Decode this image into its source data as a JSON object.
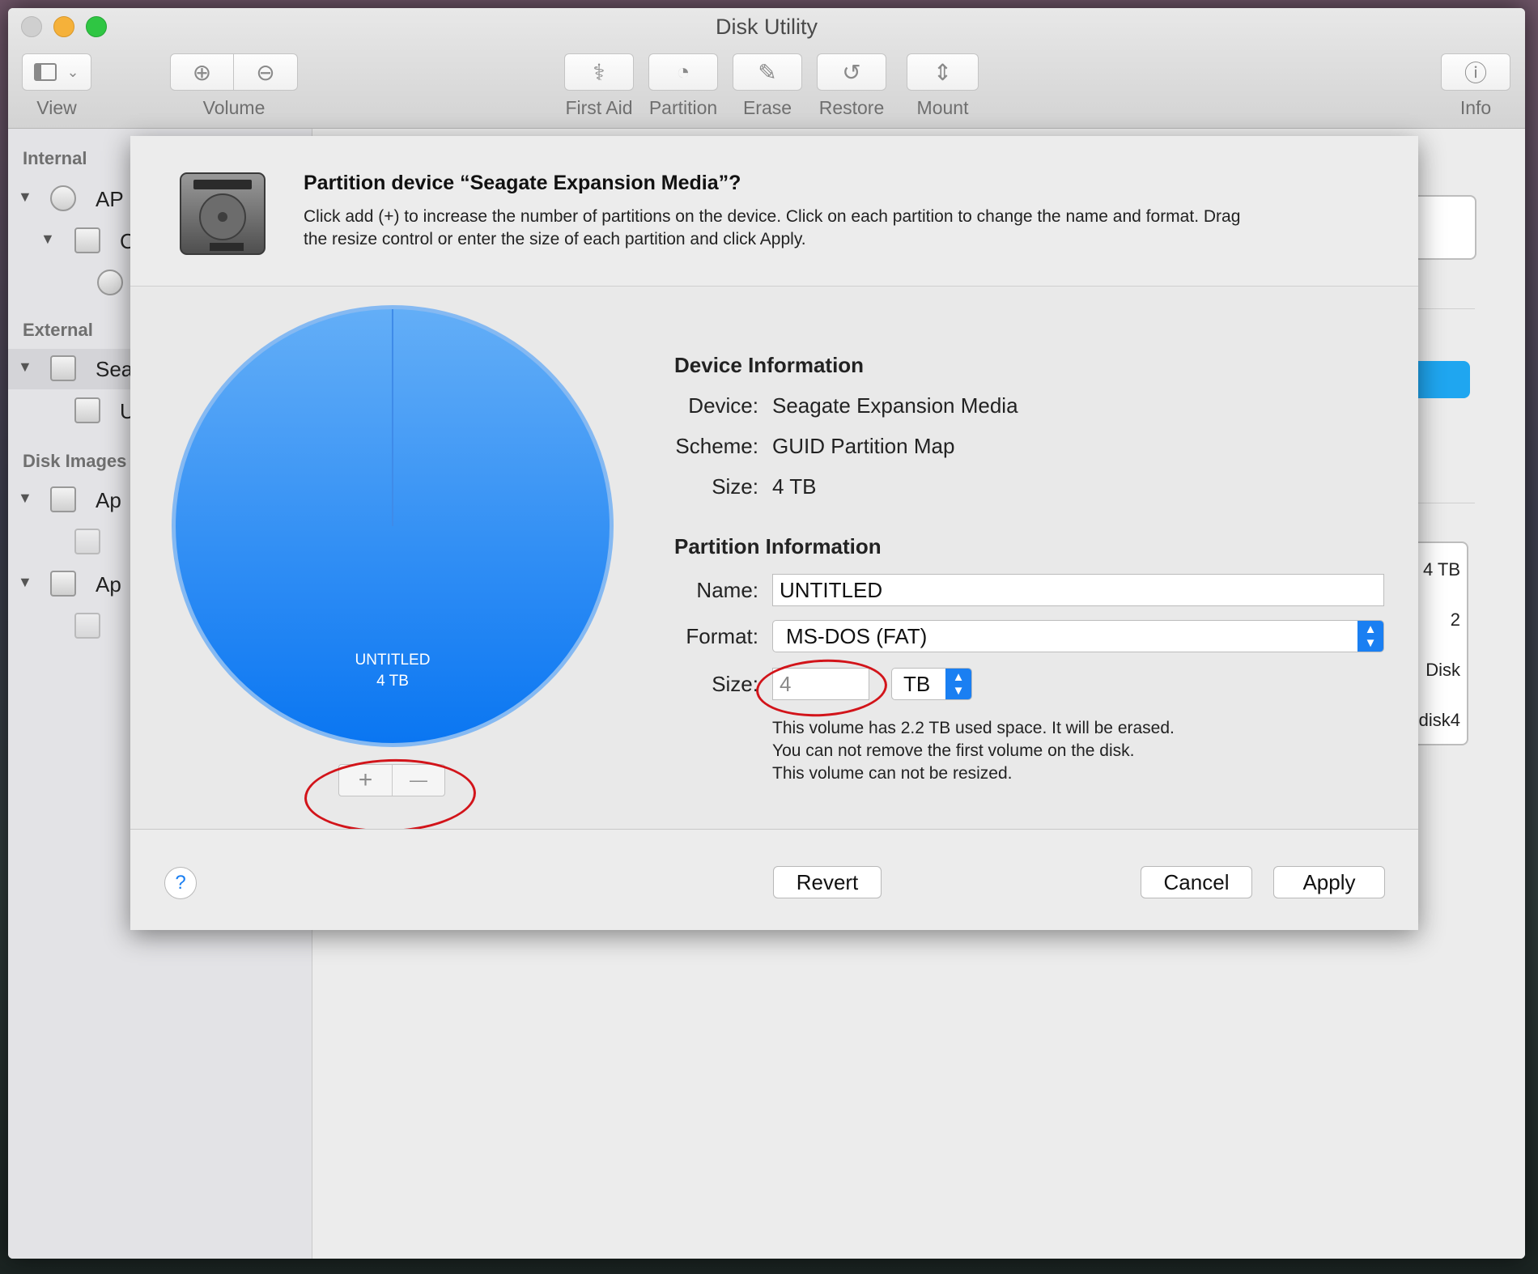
{
  "window": {
    "title": "Disk Utility"
  },
  "toolbar": {
    "view_label": "View",
    "volume_label": "Volume",
    "first_aid_label": "First Aid",
    "partition_label": "Partition",
    "erase_label": "Erase",
    "restore_label": "Restore",
    "mount_label": "Mount",
    "info_label": "Info"
  },
  "sidebar": {
    "internal_header": "Internal",
    "external_header": "External",
    "disk_images_header": "Disk Images",
    "items": [
      {
        "label": "AP"
      },
      {
        "label": "C"
      },
      {
        "label": "Sea"
      },
      {
        "label": "U"
      },
      {
        "label": "Ap"
      },
      {
        "label": "Ap"
      }
    ]
  },
  "right_pane": {
    "values": [
      "4 TB",
      "2",
      "Disk",
      "disk4"
    ]
  },
  "sheet": {
    "title": "Partition device “Seagate Expansion Media”?",
    "description_line1": "Click add (+) to increase the number of partitions on the device. Click on each partition to change the name and format. Drag",
    "description_line2": "the resize control or enter the size of each partition and click Apply.",
    "pie": {
      "partition_name": "UNTITLED",
      "partition_size": "4 TB",
      "color": "#1a86f5"
    },
    "add_symbol": "+",
    "remove_symbol": "—",
    "device_info": {
      "header": "Device Information",
      "device_label": "Device:",
      "device_value": "Seagate Expansion Media",
      "scheme_label": "Scheme:",
      "scheme_value": "GUID Partition Map",
      "size_label": "Size:",
      "size_value": "4 TB"
    },
    "partition_info": {
      "header": "Partition Information",
      "name_label": "Name:",
      "name_value": "UNTITLED",
      "format_label": "Format:",
      "format_value": "MS-DOS (FAT)",
      "size_label": "Size:",
      "size_value": "4",
      "size_unit": "TB",
      "note1": "This volume has 2.2 TB used space. It will be erased.",
      "note2": "You can not remove the first volume on the disk.",
      "note3": "This volume can not be resized."
    },
    "help_symbol": "?",
    "revert_label": "Revert",
    "cancel_label": "Cancel",
    "apply_label": "Apply"
  },
  "colors": {
    "accent": "#1a86f5",
    "annotation": "#d2141a"
  }
}
